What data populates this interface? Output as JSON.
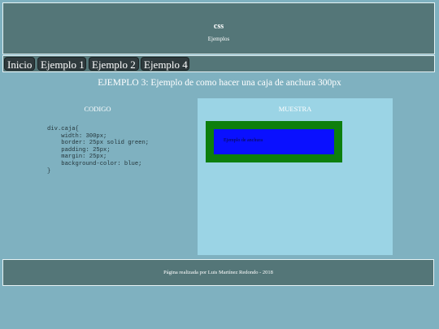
{
  "header": {
    "title": "css",
    "subtitle": "Ejemplos"
  },
  "nav": {
    "items": [
      {
        "label": "Inicio"
      },
      {
        "label": "Ejemplo 1"
      },
      {
        "label": "Ejemplo 2"
      },
      {
        "label": "Ejemplo 4"
      }
    ]
  },
  "main": {
    "heading": "EJEMPLO 3: Ejemplo de como hacer una caja de anchura 300px",
    "code_title": "CODIGO",
    "code_lines": "div.caja{\n    width: 300px;\n    border: 25px solid green;\n    padding: 25px;\n    margin: 25px;\n    background-color: blue;\n}",
    "sample_title": "MUESTRA",
    "sample_box_text": "Ejemplo de anchura"
  },
  "footer": {
    "text": "Página realizada por Luis Martínez Redondo - 2018"
  },
  "colors": {
    "page_background": "#7fb1c0",
    "bar_background": "#547678",
    "button_background": "#2f3a3d",
    "sample_panel": "#9bd4e5",
    "demo_border": "#0d7f0d",
    "demo_fill": "#0a10ff"
  }
}
